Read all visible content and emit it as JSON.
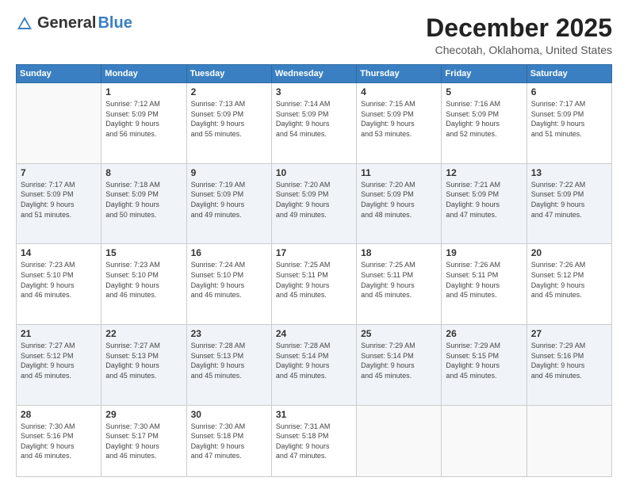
{
  "header": {
    "logo_general": "General",
    "logo_blue": "Blue",
    "month": "December 2025",
    "location": "Checotah, Oklahoma, United States"
  },
  "weekdays": [
    "Sunday",
    "Monday",
    "Tuesday",
    "Wednesday",
    "Thursday",
    "Friday",
    "Saturday"
  ],
  "weeks": [
    [
      {
        "day": "",
        "info": ""
      },
      {
        "day": "1",
        "info": "Sunrise: 7:12 AM\nSunset: 5:09 PM\nDaylight: 9 hours\nand 56 minutes."
      },
      {
        "day": "2",
        "info": "Sunrise: 7:13 AM\nSunset: 5:09 PM\nDaylight: 9 hours\nand 55 minutes."
      },
      {
        "day": "3",
        "info": "Sunrise: 7:14 AM\nSunset: 5:09 PM\nDaylight: 9 hours\nand 54 minutes."
      },
      {
        "day": "4",
        "info": "Sunrise: 7:15 AM\nSunset: 5:09 PM\nDaylight: 9 hours\nand 53 minutes."
      },
      {
        "day": "5",
        "info": "Sunrise: 7:16 AM\nSunset: 5:09 PM\nDaylight: 9 hours\nand 52 minutes."
      },
      {
        "day": "6",
        "info": "Sunrise: 7:17 AM\nSunset: 5:09 PM\nDaylight: 9 hours\nand 51 minutes."
      }
    ],
    [
      {
        "day": "7",
        "info": "Sunrise: 7:17 AM\nSunset: 5:09 PM\nDaylight: 9 hours\nand 51 minutes."
      },
      {
        "day": "8",
        "info": "Sunrise: 7:18 AM\nSunset: 5:09 PM\nDaylight: 9 hours\nand 50 minutes."
      },
      {
        "day": "9",
        "info": "Sunrise: 7:19 AM\nSunset: 5:09 PM\nDaylight: 9 hours\nand 49 minutes."
      },
      {
        "day": "10",
        "info": "Sunrise: 7:20 AM\nSunset: 5:09 PM\nDaylight: 9 hours\nand 49 minutes."
      },
      {
        "day": "11",
        "info": "Sunrise: 7:20 AM\nSunset: 5:09 PM\nDaylight: 9 hours\nand 48 minutes."
      },
      {
        "day": "12",
        "info": "Sunrise: 7:21 AM\nSunset: 5:09 PM\nDaylight: 9 hours\nand 47 minutes."
      },
      {
        "day": "13",
        "info": "Sunrise: 7:22 AM\nSunset: 5:09 PM\nDaylight: 9 hours\nand 47 minutes."
      }
    ],
    [
      {
        "day": "14",
        "info": "Sunrise: 7:23 AM\nSunset: 5:10 PM\nDaylight: 9 hours\nand 46 minutes."
      },
      {
        "day": "15",
        "info": "Sunrise: 7:23 AM\nSunset: 5:10 PM\nDaylight: 9 hours\nand 46 minutes."
      },
      {
        "day": "16",
        "info": "Sunrise: 7:24 AM\nSunset: 5:10 PM\nDaylight: 9 hours\nand 46 minutes."
      },
      {
        "day": "17",
        "info": "Sunrise: 7:25 AM\nSunset: 5:11 PM\nDaylight: 9 hours\nand 45 minutes."
      },
      {
        "day": "18",
        "info": "Sunrise: 7:25 AM\nSunset: 5:11 PM\nDaylight: 9 hours\nand 45 minutes."
      },
      {
        "day": "19",
        "info": "Sunrise: 7:26 AM\nSunset: 5:11 PM\nDaylight: 9 hours\nand 45 minutes."
      },
      {
        "day": "20",
        "info": "Sunrise: 7:26 AM\nSunset: 5:12 PM\nDaylight: 9 hours\nand 45 minutes."
      }
    ],
    [
      {
        "day": "21",
        "info": "Sunrise: 7:27 AM\nSunset: 5:12 PM\nDaylight: 9 hours\nand 45 minutes."
      },
      {
        "day": "22",
        "info": "Sunrise: 7:27 AM\nSunset: 5:13 PM\nDaylight: 9 hours\nand 45 minutes."
      },
      {
        "day": "23",
        "info": "Sunrise: 7:28 AM\nSunset: 5:13 PM\nDaylight: 9 hours\nand 45 minutes."
      },
      {
        "day": "24",
        "info": "Sunrise: 7:28 AM\nSunset: 5:14 PM\nDaylight: 9 hours\nand 45 minutes."
      },
      {
        "day": "25",
        "info": "Sunrise: 7:29 AM\nSunset: 5:14 PM\nDaylight: 9 hours\nand 45 minutes."
      },
      {
        "day": "26",
        "info": "Sunrise: 7:29 AM\nSunset: 5:15 PM\nDaylight: 9 hours\nand 45 minutes."
      },
      {
        "day": "27",
        "info": "Sunrise: 7:29 AM\nSunset: 5:16 PM\nDaylight: 9 hours\nand 46 minutes."
      }
    ],
    [
      {
        "day": "28",
        "info": "Sunrise: 7:30 AM\nSunset: 5:16 PM\nDaylight: 9 hours\nand 46 minutes."
      },
      {
        "day": "29",
        "info": "Sunrise: 7:30 AM\nSunset: 5:17 PM\nDaylight: 9 hours\nand 46 minutes."
      },
      {
        "day": "30",
        "info": "Sunrise: 7:30 AM\nSunset: 5:18 PM\nDaylight: 9 hours\nand 47 minutes."
      },
      {
        "day": "31",
        "info": "Sunrise: 7:31 AM\nSunset: 5:18 PM\nDaylight: 9 hours\nand 47 minutes."
      },
      {
        "day": "",
        "info": ""
      },
      {
        "day": "",
        "info": ""
      },
      {
        "day": "",
        "info": ""
      }
    ]
  ]
}
